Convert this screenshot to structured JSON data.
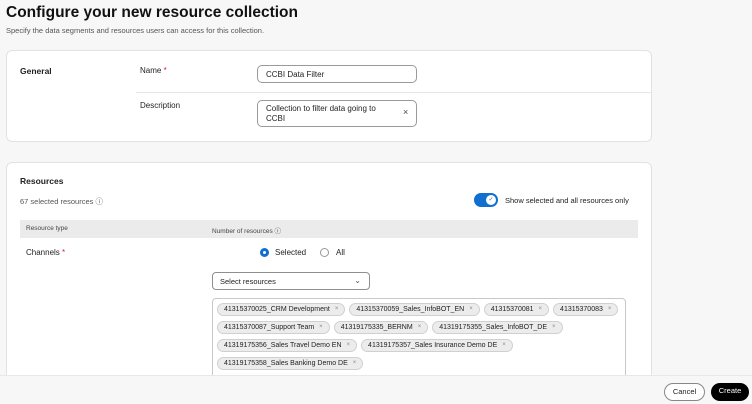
{
  "header": {
    "title": "Configure your new resource collection",
    "subtitle": "Specify the data segments and resources users can access for this collection."
  },
  "general": {
    "section_label": "General",
    "name_label": "Name",
    "required_mark": "*",
    "name_value": "CCBI Data Filter",
    "description_label": "Description",
    "description_value": "Collection to filter data going to CCBI",
    "clear_icon": "×"
  },
  "resources": {
    "section_label": "Resources",
    "selected_count": "67 selected resources",
    "info_icon": "ⓘ",
    "toggle_label": "Show selected and all resources only",
    "toggle_on": true,
    "table": {
      "col_type": "Resource type",
      "col_number": "Number of resources"
    },
    "channels": {
      "label": "Channels",
      "required_mark": "*",
      "radio_selected": "Selected",
      "radio_all": "All",
      "select_placeholder": "Select resources",
      "tags": [
        "41315370025_CRM Development",
        "41315370059_Sales_InfoBOT_EN",
        "41315370081",
        "41315370083",
        "41315370087_Support Team",
        "41319175335_BERNM",
        "41319175355_Sales_InfoBOT_DE",
        "41319175356_Sales Travel Demo EN",
        "41319175357_Sales Insurance Demo DE",
        "41319175358_Sales Banking Demo DE"
      ]
    }
  },
  "footer": {
    "cancel": "Cancel",
    "create": "Create"
  },
  "colors": {
    "accent": "#1170cf",
    "required": "#d0263d"
  }
}
